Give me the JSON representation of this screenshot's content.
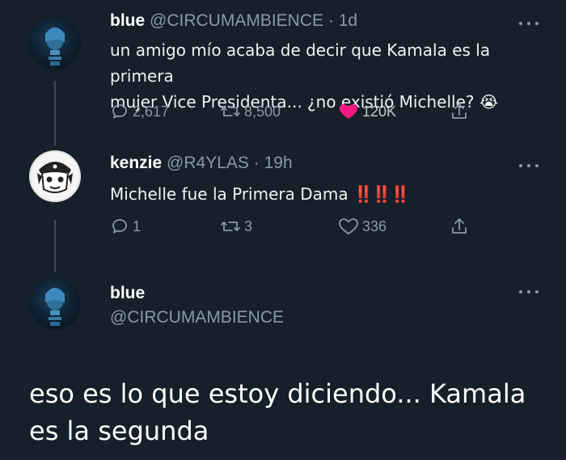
{
  "tweets": [
    {
      "name": "blue",
      "handle": "@CIRCUMAMBIENCE",
      "time": "1d",
      "text_line1": "un amigo mío acaba de decir que Kamala es la primera",
      "text_line2": "mujer Vice Presidenta... ¿no existió Michelle?",
      "emoji": "😭",
      "replies": "2,617",
      "retweets": "8,500",
      "likes": "120K",
      "liked": true
    },
    {
      "name": "kenzie",
      "handle": "@R4YLAS",
      "time": "19h",
      "text": "Michelle fue la Primera Dama",
      "emphasis": "‼️‼️‼️",
      "replies": "1",
      "retweets": "3",
      "likes": "336",
      "liked": false
    },
    {
      "name": "blue",
      "handle": "@CIRCUMAMBIENCE"
    }
  ],
  "separator": "·",
  "reply_text": "eso es lo que estoy diciendo... Kamala es la segunda",
  "colors": {
    "background": "#15202b",
    "like_active": "#f91880",
    "muted": "#8b98a5"
  },
  "icons": [
    "reply-icon",
    "retweet-icon",
    "like-icon",
    "share-icon",
    "more-icon"
  ]
}
